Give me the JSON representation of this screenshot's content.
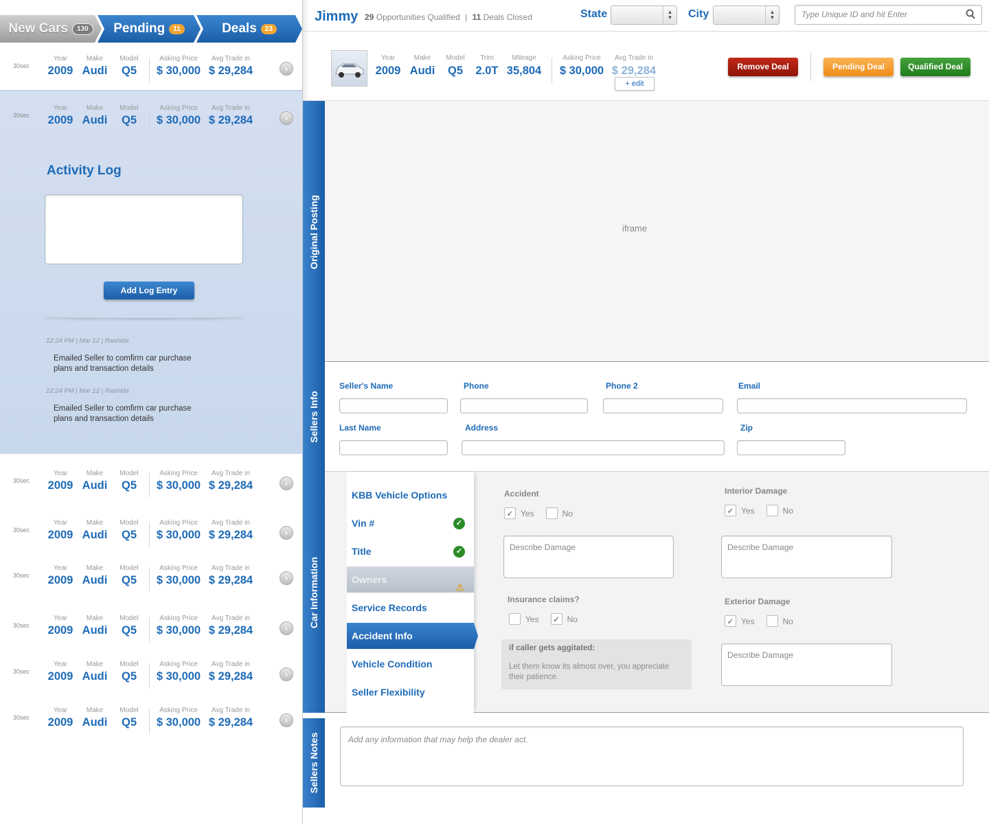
{
  "tabs": [
    {
      "label": "New Cars",
      "count": "130"
    },
    {
      "label": "Pending",
      "count": "11"
    },
    {
      "label": "Deals",
      "count": "23"
    }
  ],
  "columns": {
    "year": "Year",
    "make": "Make",
    "model": "Model",
    "asking": "Asking Price",
    "avg": "Avg Trade in"
  },
  "car_rows": [
    {
      "time": "30sec",
      "year": "2009",
      "make": "Audi",
      "model": "Q5",
      "asking": "$ 30,000",
      "avg": "$ 29,284"
    },
    {
      "time": "30sec",
      "year": "2009",
      "make": "Audi",
      "model": "Q5",
      "asking": "$ 30,000",
      "avg": "$ 29,284"
    },
    {
      "time": "30sec",
      "year": "2009",
      "make": "Audi",
      "model": "Q5",
      "asking": "$ 30,000",
      "avg": "$ 29,284"
    },
    {
      "time": "30sec",
      "year": "2009",
      "make": "Audi",
      "model": "Q5",
      "asking": "$ 30,000",
      "avg": "$ 29,284"
    },
    {
      "time": "30sec",
      "year": "2009",
      "make": "Audi",
      "model": "Q5",
      "asking": "$ 30,000",
      "avg": "$ 29,284"
    },
    {
      "time": "30sec",
      "year": "2009",
      "make": "Audi",
      "model": "Q5",
      "asking": "$ 30,000",
      "avg": "$ 29,284"
    },
    {
      "time": "30sec",
      "year": "2009",
      "make": "Audi",
      "model": "Q5",
      "asking": "$ 30,000",
      "avg": "$ 29,284"
    },
    {
      "time": "30sec",
      "year": "2009",
      "make": "Audi",
      "model": "Q5",
      "asking": "$ 30,000",
      "avg": "$ 29,284"
    }
  ],
  "activity": {
    "title": "Activity Log",
    "add_button": "Add Log Entry",
    "entries": [
      {
        "meta": "12:24 PM |  Mar 12  |  Rashida",
        "text": "Emailed Seller to comfirm car purchase plans and transaction details"
      },
      {
        "meta": "12:24 PM |  Mar 12  |  Rashida",
        "text": "Emailed Seller to comfirm car purchase plans and transaction details"
      }
    ]
  },
  "topbar": {
    "user": "Jimmy",
    "opps_count": "29",
    "opps_label": "Opportunities Qualified",
    "separator": "|",
    "deals_count": "11",
    "deals_label": "Deals Closed",
    "state_label": "State",
    "city_label": "City",
    "search_placeholder": "Type Unique ID and hit Enter"
  },
  "deal": {
    "labels": {
      "year": "Year",
      "make": "Make",
      "model": "Model",
      "trim": "Trim",
      "mileage": "Mileage",
      "asking": "Asking Price",
      "avg": "Avg Trade in"
    },
    "year": "2009",
    "make": "Audi",
    "model": "Q5",
    "trim": "2.0T",
    "mileage": "35,804",
    "asking": "$ 30,000",
    "avg": "$ 29,284",
    "edit": "+ edit",
    "remove": "Remove Deal",
    "pending": "Pending Deal",
    "qualified": "Qualified Deal"
  },
  "sections": {
    "original": "Original Posting",
    "iframe": "iframe",
    "sellers": "Sellers Info",
    "carinfo": "Car Information",
    "notes": "Sellers Notes"
  },
  "sellers_fields": {
    "name": "Seller's Name",
    "phone": "Phone",
    "phone2": "Phone 2",
    "email": "Email",
    "last": "Last Name",
    "address": "Address",
    "zip": "Zip"
  },
  "car_menu": [
    {
      "label": "KBB Vehicle Options",
      "status": ""
    },
    {
      "label": "Vin #",
      "status": "check"
    },
    {
      "label": "Title",
      "status": "check"
    },
    {
      "label": "Owners",
      "status": "warning"
    },
    {
      "label": "Service Records",
      "status": ""
    },
    {
      "label": "Accident Info",
      "status": "active"
    },
    {
      "label": "Vehicle Condition",
      "status": ""
    },
    {
      "label": "Seller Flexibility",
      "status": ""
    }
  ],
  "accident": {
    "accident_label": "Accident",
    "interior_label": "Interior Damage",
    "insurance_label": "Insurance claims?",
    "exterior_label": "Exterior Damage",
    "yes": "Yes",
    "no": "No",
    "describe": "Describe Damage",
    "hint_title": "if caller gets aggitated:",
    "hint_text": "Let them know its almost over, you appreciate their patience."
  },
  "notes_placeholder": "Add any information that may help the dealer act.",
  "colors": {
    "accent": "#1e6bb8",
    "remove": "#a81d10",
    "pending": "#f5a03a",
    "qualified": "#2f8e29"
  }
}
